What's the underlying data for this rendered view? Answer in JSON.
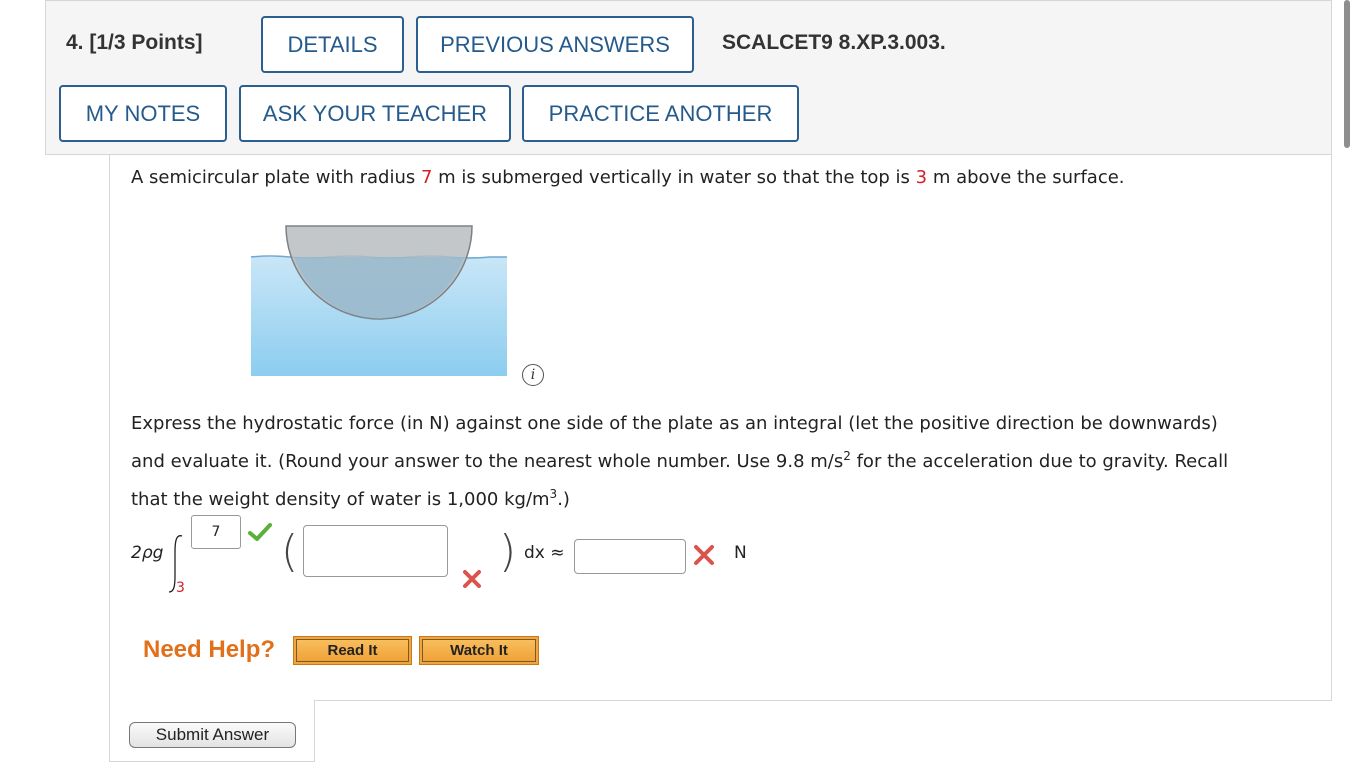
{
  "header": {
    "question_number": "4.",
    "points": "[1/3 Points]",
    "details_label": "DETAILS",
    "previous_answers_label": "PREVIOUS ANSWERS",
    "problem_id": "SCALCET9 8.XP.3.003.",
    "my_notes_label": "MY NOTES",
    "ask_teacher_label": "ASK YOUR TEACHER",
    "practice_another_label": "PRACTICE ANOTHER"
  },
  "question": {
    "intro_part1": "A semicircular plate with radius ",
    "radius": "7",
    "intro_part2": " m is submerged vertically in water so that the top is ",
    "height_above": "3",
    "intro_part3": " m above the surface.",
    "instruction_line1": "Express the hydrostatic force (in N) against one side of the plate as an integral (let the positive direction be downwards)",
    "instruction_line2_a": "and evaluate it. (Round your answer to the nearest whole number. Use 9.8 m/s",
    "instruction_line2_sup": "2",
    "instruction_line2_b": " for the acceleration due to gravity. Recall",
    "instruction_line3_a": "that the weight density of water is 1,000 kg/m",
    "instruction_line3_sup": "3",
    "instruction_line3_b": ".)"
  },
  "integral": {
    "prefix": "2ρg",
    "upper_limit_value": "7",
    "lower_limit": "3",
    "integrand_value": "",
    "dx_label": "dx ≈",
    "result_value": "",
    "unit": "N"
  },
  "status": {
    "upper_limit": "correct",
    "integrand": "incorrect",
    "result": "incorrect",
    "correct_color": "#5bb03a",
    "incorrect_color": "#d9534f"
  },
  "help": {
    "need_help_label": "Need Help?",
    "read_it_label": "Read It",
    "watch_it_label": "Watch It"
  },
  "submit_label": "Submit Answer",
  "info_icon_glyph": "i",
  "colors": {
    "link_blue": "#255a8c",
    "highlight_red": "#d31f26",
    "help_orange": "#e2701a",
    "water_top": "#c9e6f7",
    "water_bottom": "#8ccdef",
    "plate_gray": "#b9bdc1"
  }
}
